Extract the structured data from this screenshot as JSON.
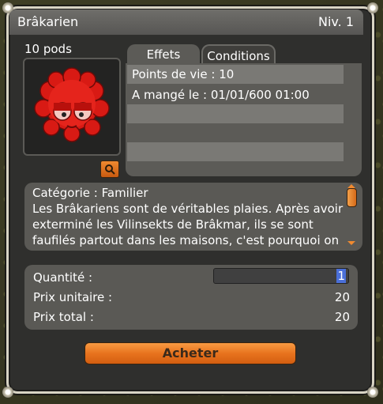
{
  "window": {
    "title": "Brâkarien",
    "level": "Niv. 1"
  },
  "item": {
    "weight": "10 pods",
    "icon": "red-pet-creature"
  },
  "tabs": [
    {
      "label": "Effets",
      "active": true
    },
    {
      "label": "Conditions",
      "active": false
    }
  ],
  "effects": [
    "Points de vie : 10",
    "A mangé le : 01/01/600 01:00"
  ],
  "description": {
    "category": "Catégorie : Familier",
    "text": "Les Brâkariens sont de véritables plaies. Après avoir exterminé les Vilinsekts de Brâkmar, ils se sont faufilés partout dans les maisons, c'est pourquoi on"
  },
  "pricing": {
    "quantity_label": "Quantité :",
    "quantity_value": "1",
    "unit_price_label": "Prix unitaire :",
    "unit_price_value": "20",
    "total_price_label": "Prix total :",
    "total_price_value": "20"
  },
  "buy_button": "Acheter",
  "colors": {
    "accent": "#e8731e",
    "panel": "#5a5955",
    "window_bg": "#2f2f2d"
  }
}
